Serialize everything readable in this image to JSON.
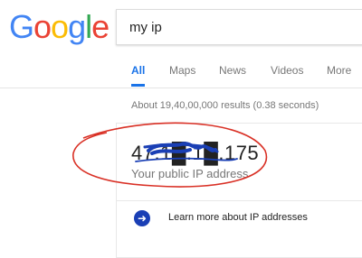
{
  "logo": {
    "letters": [
      "G",
      "o",
      "o",
      "g",
      "l",
      "e"
    ],
    "colors": [
      "#4285F4",
      "#EA4335",
      "#FBBC05",
      "#4285F4",
      "#34A853",
      "#EA4335"
    ]
  },
  "search": {
    "query": "my ip"
  },
  "tabs": [
    {
      "label": "All",
      "active": true
    },
    {
      "label": "Maps",
      "active": false
    },
    {
      "label": "News",
      "active": false
    },
    {
      "label": "Videos",
      "active": false
    },
    {
      "label": "More",
      "active": false
    }
  ],
  "results_count": "About 19,40,00,000 results (0.38 seconds)",
  "ip_card": {
    "ip": "47.1█.1█.175",
    "label": "Your public IP address",
    "more_link": "Learn more about IP addresses"
  },
  "colors": {
    "accent": "#1a73e8",
    "annotation": "#d93025",
    "scribble": "#1a3fb5"
  }
}
